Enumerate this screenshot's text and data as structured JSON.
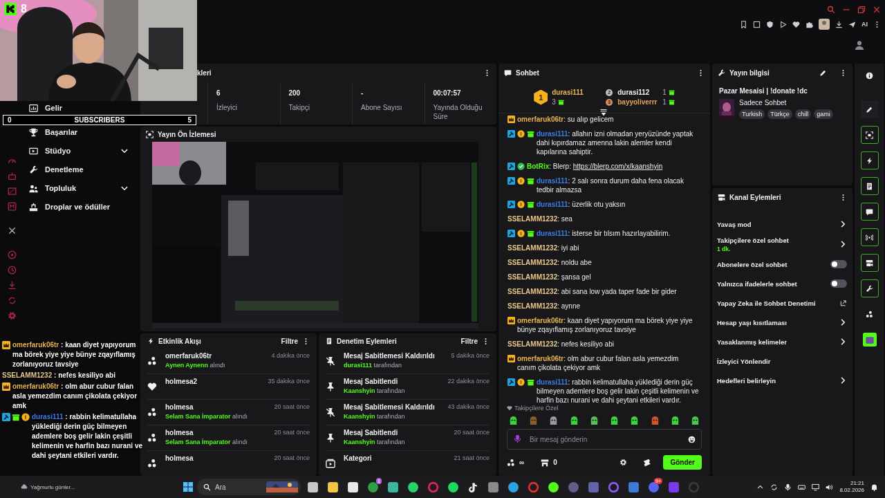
{
  "top_bar": {
    "ai_label": "AI"
  },
  "webcam": {
    "kind": "picture",
    "badge": "8",
    "subscribers": {
      "current": "0",
      "label": "SUBSCRIBERS",
      "goal": "5"
    }
  },
  "sidebar": {
    "items": [
      {
        "kind": "chart",
        "label": "Gelir",
        "expandable": false
      },
      {
        "kind": "trophy",
        "label": "Başarılar",
        "expandable": false
      },
      {
        "kind": "film",
        "label": "Stüdyo",
        "expandable": true
      },
      {
        "kind": "wrench",
        "label": "Denetleme",
        "expandable": false
      },
      {
        "kind": "people",
        "label": "Topluluk",
        "expandable": true
      },
      {
        "kind": "drops",
        "label": "Droplar ve ödüller",
        "expandable": false
      }
    ]
  },
  "stats": {
    "title": "kleri",
    "items": [
      {
        "value": "6",
        "label": "İzleyici"
      },
      {
        "value": "200",
        "label": "Takipçi"
      },
      {
        "value": "-",
        "label": "Abone Sayısı"
      },
      {
        "value": "00:07:57",
        "label": "Yayında Olduğu Süre"
      }
    ]
  },
  "preview": {
    "title": "Yayın Ön İzlemesi",
    "kind": "picture"
  },
  "activity": {
    "title": "Etkinlik Akışı",
    "filter": "Filtre",
    "items": [
      {
        "kind": "group",
        "user": "omerfaruk06tr",
        "time": "4 dakika önce",
        "reward": "Aynen Aynenn",
        "action": "alındı"
      },
      {
        "kind": "heart",
        "user": "holmesa2",
        "time": "35 dakika önce"
      },
      {
        "kind": "group",
        "user": "holmesa",
        "time": "20 saat önce",
        "reward": "Selam Sana İmparator",
        "action": "alındı"
      },
      {
        "kind": "group",
        "user": "holmesa",
        "time": "20 saat önce",
        "reward": "Selam Sana İmparator",
        "action": "alındı"
      },
      {
        "kind": "group",
        "user": "holmesa",
        "time": "20 saat önce"
      }
    ]
  },
  "moderation": {
    "title": "Denetim Eylemleri",
    "filter": "Filtre",
    "items": [
      {
        "kind": "unpin",
        "title": "Mesaj Sabitlemesi Kaldırıldı",
        "time": "5 dakika önce",
        "actor": "durasi111",
        "suffix": "tarafından"
      },
      {
        "kind": "pin",
        "title": "Mesaj Sabitlendi",
        "time": "22 dakika önce",
        "actor": "Kaanshyin",
        "suffix": "tarafından"
      },
      {
        "kind": "unpin",
        "title": "Mesaj Sabitlemesi Kaldırıldı",
        "time": "43 dakika önce",
        "actor": "Kaanshyin",
        "suffix": "tarafından"
      },
      {
        "kind": "pin",
        "title": "Mesaj Sabitlendi",
        "time": "20 saat önce",
        "actor": "Kaanshyin",
        "suffix": "tarafından"
      },
      {
        "kind": "category",
        "title": "Kategori",
        "time": "21 saat önce"
      }
    ]
  },
  "chat": {
    "title": "Sohbet",
    "leaders": [
      {
        "rank": "1",
        "name": "durasi111",
        "count": "3"
      },
      {
        "rank": "2",
        "name": "durasi112",
        "count": "1"
      },
      {
        "rank": "3",
        "name": "bayyoliverrr",
        "count": "1"
      }
    ],
    "messages": [
      {
        "badges": [
          {
            "kind": "crown"
          }
        ],
        "user": "omerfaruk06tr",
        "color": "#e8b651",
        "text": ": su alıp gelicem"
      },
      {
        "badges": [
          {
            "kind": "mod"
          },
          {
            "kind": "tier"
          },
          {
            "kind": "gift"
          }
        ],
        "user": "durasi111",
        "color": "#3b7ce6",
        "text": ": allahın izni olmadan yeryüzünde yaptak dahi kıpırdamaz amenna lakin alemler kendi kapılarına sahiptir."
      },
      {
        "badges": [
          {
            "kind": "mod"
          },
          {
            "kind": "verified"
          }
        ],
        "user": "BotRix",
        "color": "#53fc18",
        "text": ": Blerp: ",
        "link": "https://blerp.com/x/kaanshyin"
      },
      {
        "badges": [
          {
            "kind": "mod"
          },
          {
            "kind": "tier"
          },
          {
            "kind": "gift"
          }
        ],
        "user": "durasi111",
        "color": "#3b7ce6",
        "text": ": 2 salı sonra durum daha fena olacak tedbir almazsa"
      },
      {
        "badges": [
          {
            "kind": "mod"
          },
          {
            "kind": "tier"
          },
          {
            "kind": "gift"
          }
        ],
        "user": "durasi111",
        "color": "#3b7ce6",
        "text": ": üzerlik otu yaksın"
      },
      {
        "user": "SSELAMM1232",
        "color": "#e9c98b",
        "text": ": sea"
      },
      {
        "badges": [
          {
            "kind": "mod"
          },
          {
            "kind": "tier"
          },
          {
            "kind": "gift"
          }
        ],
        "user": "durasi111",
        "color": "#3b7ce6",
        "text": ": isterse bir tılsım hazırlayabilirim."
      },
      {
        "user": "SSELAMM1232",
        "color": "#e9c98b",
        "text": ": iyi abi"
      },
      {
        "user": "SSELAMM1232",
        "color": "#e9c98b",
        "text": ": noldu abe"
      },
      {
        "user": "SSELAMM1232",
        "color": "#e9c98b",
        "text": ": şansa gel"
      },
      {
        "user": "SSELAMM1232",
        "color": "#e9c98b",
        "text": ": abi sana low yada taper fade bir gider"
      },
      {
        "user": "SSELAMM1232",
        "color": "#e9c98b",
        "text": ": aynne"
      },
      {
        "badges": [
          {
            "kind": "crown"
          }
        ],
        "user": "omerfaruk06tr",
        "color": "#e8b651",
        "text": ": kaan diyet yapıyorum ma börek yiye yiye bünye zqayıflamış zorlanıyoruz tavsiye"
      },
      {
        "user": "SSELAMM1232",
        "color": "#e9c98b",
        "text": ": nefes kesiliyo abi"
      },
      {
        "badges": [
          {
            "kind": "crown"
          }
        ],
        "user": "omerfaruk06tr",
        "color": "#e8b651",
        "text": ": olm abur cubur falan asla yemezdim canım çikolata çekiyor amk"
      },
      {
        "badges": [
          {
            "kind": "mod"
          },
          {
            "kind": "tier"
          },
          {
            "kind": "gift"
          }
        ],
        "user": "durasi111",
        "color": "#3b7ce6",
        "text": ": rabbin kelimatullaha yüklediği derin güç bilmeyen ademlere boş gelir lakin çeşitli kelimenin ve harfin bazı nurani ve dahi şeytani etkileri vardır."
      }
    ],
    "follower_label": "Takipçilere Özel",
    "input": {
      "placeholder": "Bir mesaj gönderin"
    },
    "points": "∞",
    "store_count": "0",
    "send": "Gönder"
  },
  "stream_info": {
    "title": "Yayın bilgisi",
    "stream_title": "Pazar Mesaisi | !donate !dc",
    "category": "Sadece Sohbet",
    "tags": [
      "Turkish",
      "Türkçe",
      "chill",
      "gami"
    ]
  },
  "channel_actions": {
    "title": "Kanal Eylemleri",
    "items": [
      {
        "kind": "link",
        "label": "Yavaş mod"
      },
      {
        "kind": "link",
        "label": "Takipçilere özel sohbet",
        "sub": "1 dk."
      },
      {
        "kind": "toggle",
        "label": "Abonelere özel sohbet",
        "on": false
      },
      {
        "kind": "toggle",
        "label": "Yalnızca ifadelerle sohbet",
        "on": false
      },
      {
        "kind": "external",
        "label": "Yapay Zeka ile Sohbet Denetimi"
      },
      {
        "kind": "link",
        "label": "Hesap yaşı kısıtlaması"
      },
      {
        "kind": "link",
        "label": "Yasaklanmış kelimeler"
      },
      {
        "kind": "plain",
        "label": "İzleyici Yönlendir"
      },
      {
        "kind": "link",
        "label": "Hedefleri belirleyin"
      }
    ]
  },
  "rail": {
    "items": [
      {
        "kind": "info",
        "on": false
      },
      {
        "kind": "pencil",
        "on": false
      },
      {
        "kind": "focus",
        "on": true
      },
      {
        "kind": "bolt",
        "on": true
      },
      {
        "kind": "doc",
        "on": true
      },
      {
        "kind": "chat",
        "on": true
      },
      {
        "kind": "signal",
        "on": true
      },
      {
        "kind": "camera",
        "on": true
      },
      {
        "kind": "wrench",
        "on": true
      },
      {
        "kind": "group",
        "on": false
      },
      {
        "kind": "app",
        "on": false
      }
    ]
  },
  "taskbar": {
    "weather": "Yağmurlu günler...",
    "search": {
      "placeholder": "Ara"
    },
    "apps": [
      {
        "kind": "taskview"
      },
      {
        "kind": "files"
      },
      {
        "kind": "store"
      },
      {
        "kind": "xbox",
        "badge": "1"
      },
      {
        "kind": "widgets"
      },
      {
        "kind": "whatsapp"
      },
      {
        "kind": "opera"
      },
      {
        "kind": "spotify"
      },
      {
        "kind": "tiktok"
      },
      {
        "kind": "gear"
      },
      {
        "kind": "telegram"
      },
      {
        "kind": "vpn"
      },
      {
        "kind": "lime"
      },
      {
        "kind": "menu"
      },
      {
        "kind": "teams"
      },
      {
        "kind": "violet"
      },
      {
        "kind": "blue"
      },
      {
        "kind": "discord",
        "badge": "9+"
      },
      {
        "kind": "stack"
      },
      {
        "kind": "obs"
      }
    ],
    "time": "21:21",
    "date": "8.02.2026"
  },
  "chat_overlay": {
    "messages": [
      {
        "badges": [
          {
            "kind": "crown"
          }
        ],
        "user": "omerfaruk06tr",
        "color": "#e8b651",
        "text": " : kaan diyet yapıyorum ma börek yiye yiye bünye zqayıflamış zorlanıyoruz tavsiye"
      },
      {
        "user": "SSELAMM1232",
        "color": "#e9c98b",
        "text": " : nefes kesiliyo abi"
      },
      {
        "badges": [
          {
            "kind": "crown"
          }
        ],
        "user": "omerfaruk06tr",
        "color": "#e8b651",
        "text": " : olm abur cubur falan asla yemezdim canım çikolata çekiyor amk"
      },
      {
        "badges": [
          {
            "kind": "mod"
          },
          {
            "kind": "gift"
          },
          {
            "kind": "tier"
          }
        ],
        "user": "durasi111",
        "color": "#3b7ce6",
        "text": " : rabbin kelimatullaha yüklediği derin güç bilmeyen ademlere boş gelir lakin çeşitli kelimenin ve harfin bazı nurani ve dahi şeytani etkileri vardır."
      }
    ]
  }
}
